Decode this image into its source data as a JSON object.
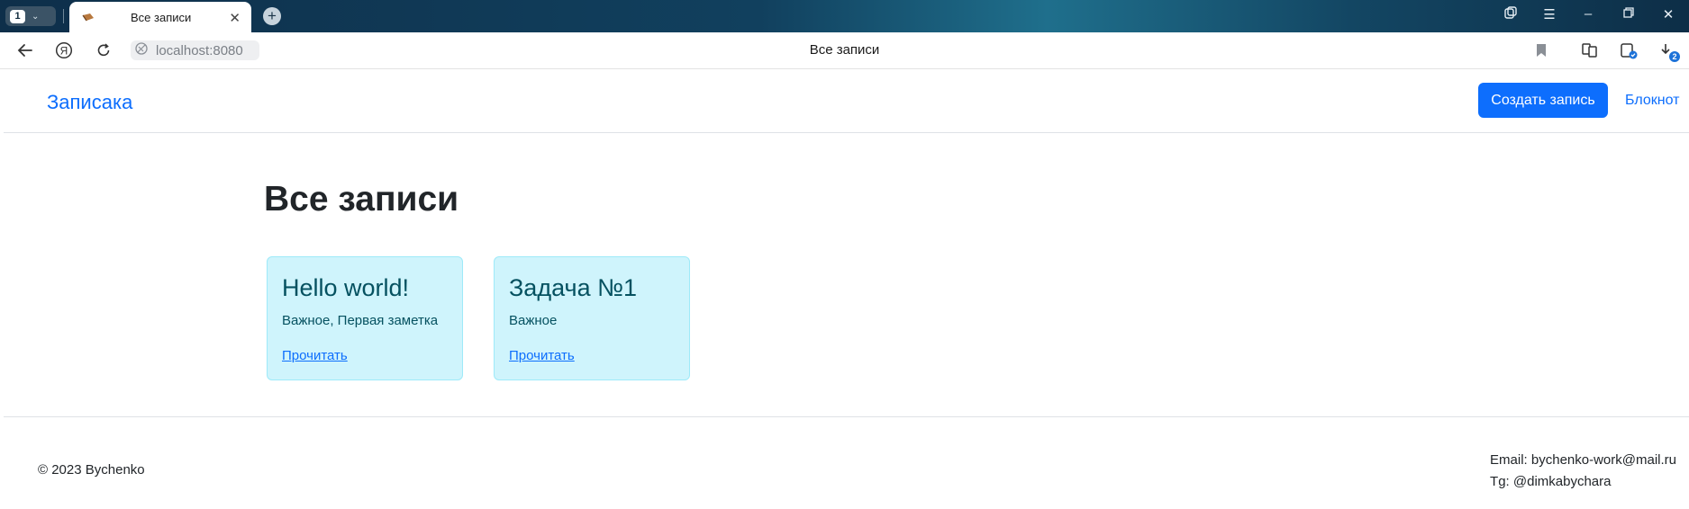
{
  "browser": {
    "tab_count": "1",
    "tab_title": "Все записи",
    "url": "localhost:8080",
    "page_title": "Все записи",
    "downloads_badge": "2"
  },
  "header": {
    "brand": "Записака",
    "create_button": "Создать запись",
    "notebook_link": "Блокнот"
  },
  "main": {
    "heading": "Все записи",
    "cards": [
      {
        "title": "Hello world!",
        "tags": "Важное, Первая заметка",
        "link": "Прочитать"
      },
      {
        "title": "Задача №1",
        "tags": "Важное",
        "link": "Прочитать"
      }
    ]
  },
  "footer": {
    "copyright": "© 2023 Bychenko",
    "email": "Email: bychenko-work@mail.ru",
    "telegram": "Tg: @dimkabychara"
  },
  "colors": {
    "primary": "#0d6efd",
    "card_bg": "#cff4fc",
    "card_text": "#055160"
  }
}
